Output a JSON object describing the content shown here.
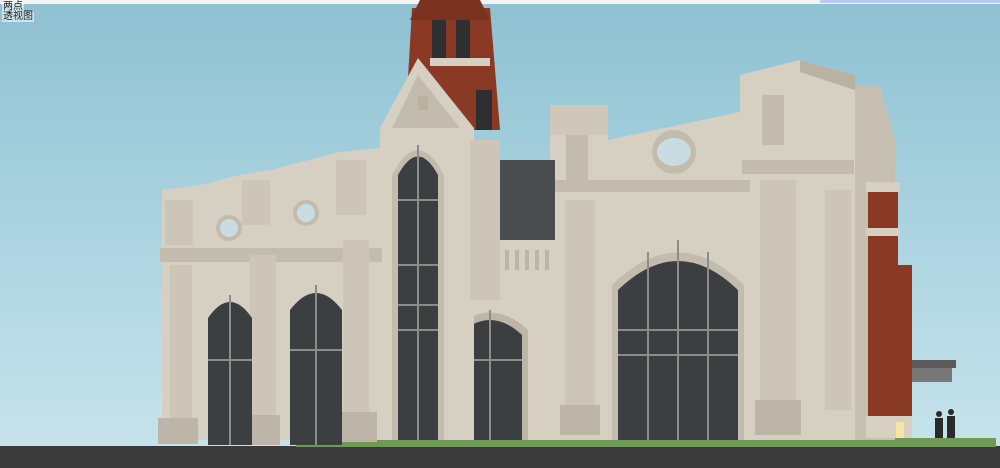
{
  "viewport": {
    "scene_name": "两点",
    "scene_label": "透视图"
  },
  "colors": {
    "sky_top": "#8ec1d2",
    "sky_bottom": "#c9e5ec",
    "stone": "#d6d0c3",
    "stone_shadow": "#b9b2a3",
    "brick": "#8a3a24",
    "glass": "#3b3f42",
    "lawn": "#6f9a55",
    "ground": "#3a3a3a"
  }
}
